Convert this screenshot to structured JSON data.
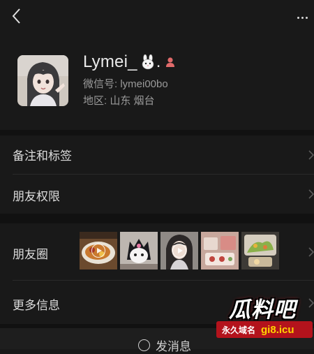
{
  "profile": {
    "name": "Lymei_",
    "name_suffix": ".",
    "wechat_id": "微信号: lymei00bo",
    "region": "地区: 山东 烟台",
    "gender_icon": "female-icon",
    "emoji_icon": "bunny-emoji-icon"
  },
  "rows": {
    "remarks": "备注和标签",
    "permissions": "朋友权限",
    "moments": "朋友圈",
    "more_info": "更多信息"
  },
  "moments_thumbs": [
    {
      "icon": "food-photo",
      "has_video": true
    },
    {
      "icon": "kuromi-photo",
      "has_video": false
    },
    {
      "icon": "girl-photo",
      "has_video": true
    },
    {
      "icon": "dessert-photo",
      "has_video": false
    },
    {
      "icon": "salad-photo",
      "has_video": false
    }
  ],
  "bottom": {
    "send_message": "发消息"
  },
  "watermark": {
    "logo": "瓜料吧",
    "sub": "永久域名",
    "domain": "gi8.icu"
  },
  "colors": {
    "background": "#191919",
    "separator": "#111111",
    "text": "#dcdcdc",
    "meta": "#9a9a9a",
    "gender": "#e06a6a"
  }
}
